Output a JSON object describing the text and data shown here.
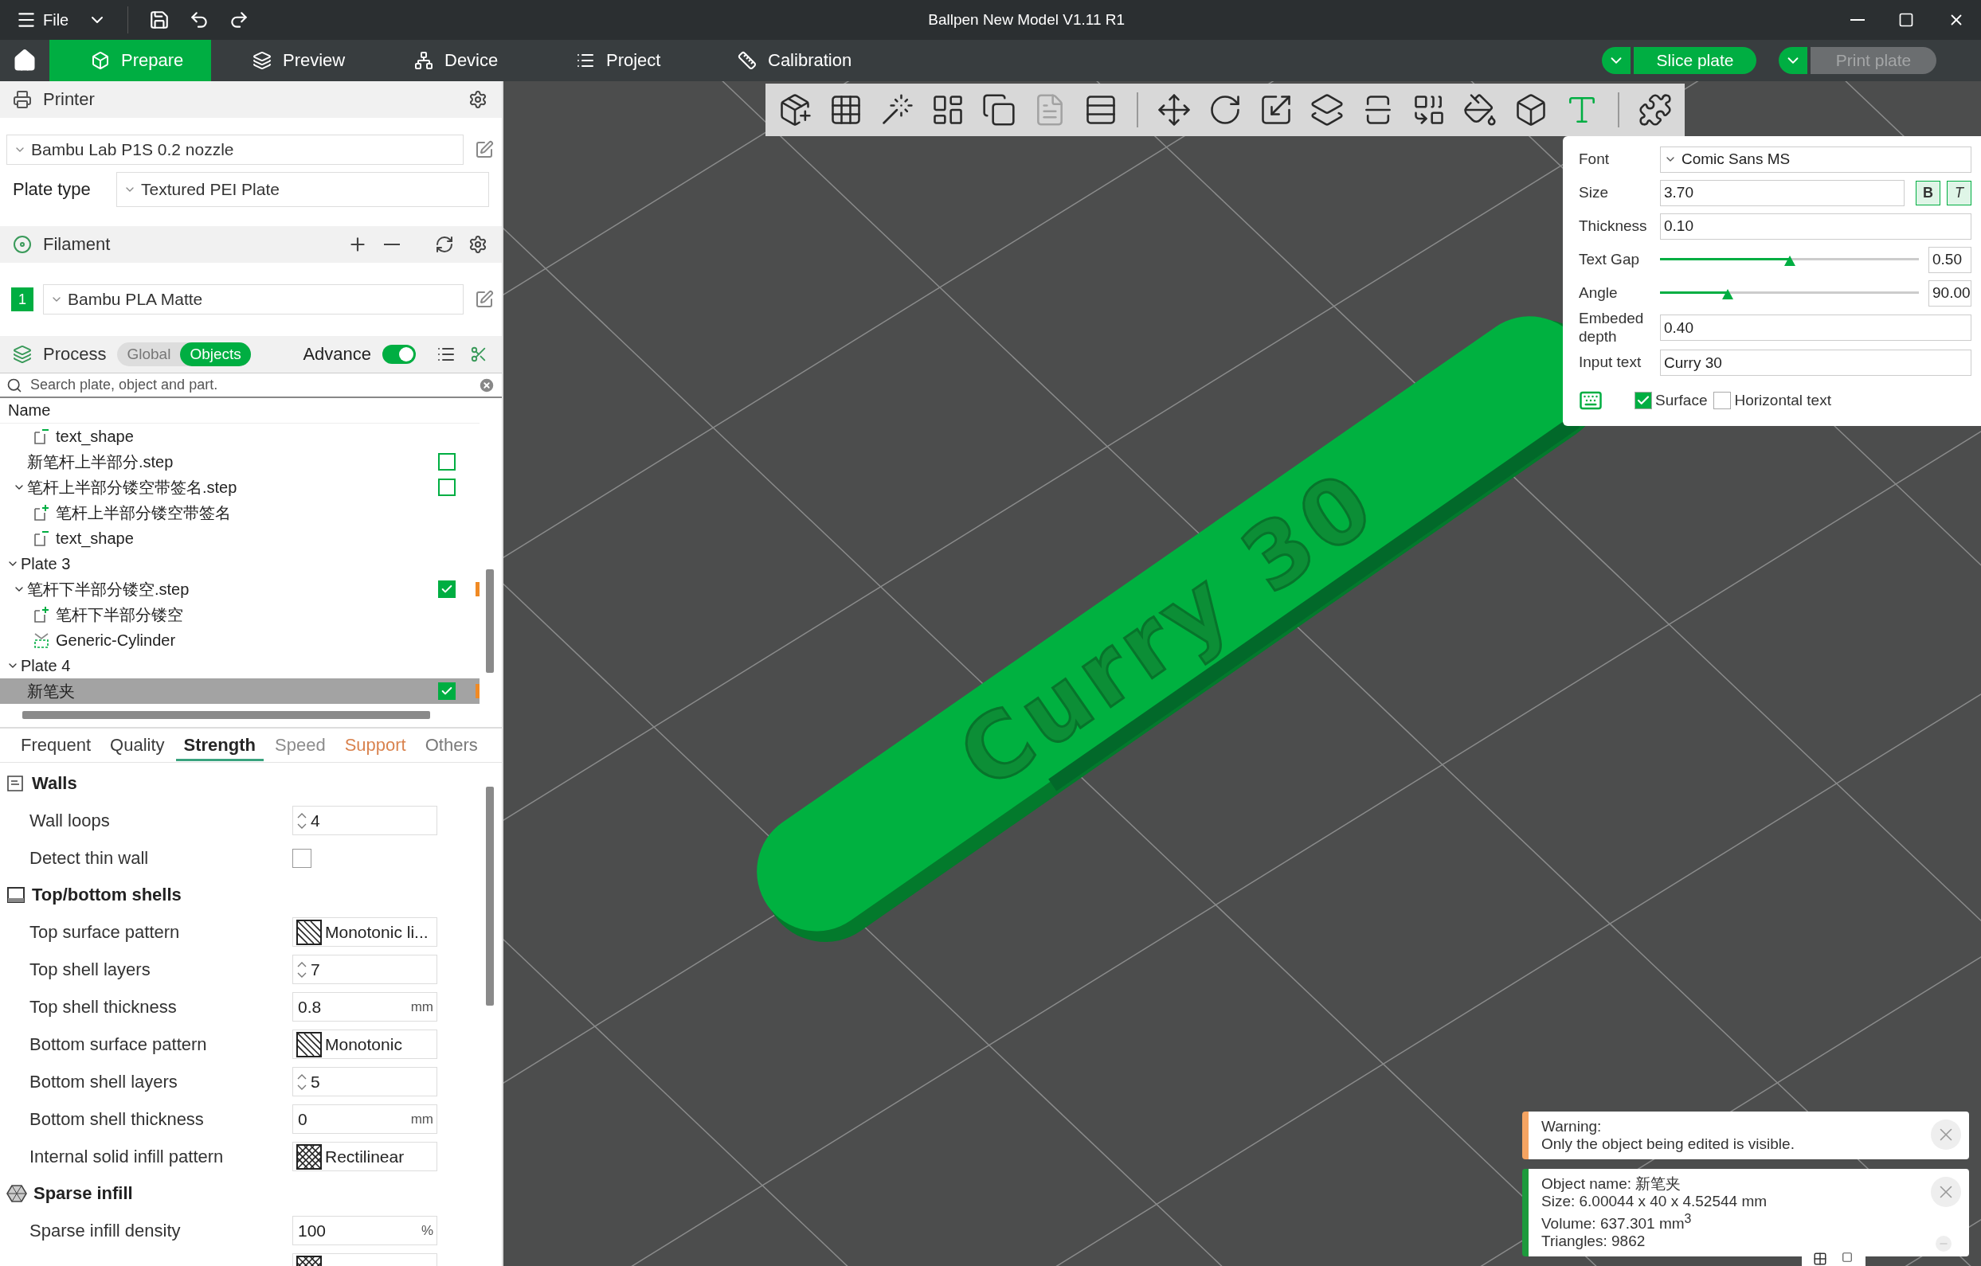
{
  "window": {
    "title": "Ballpen New Model V1.11 R1",
    "menu": "File"
  },
  "nav": {
    "tabs": [
      {
        "label": "Prepare",
        "selected": true
      },
      {
        "label": "Preview",
        "selected": false
      },
      {
        "label": "Device",
        "selected": false
      },
      {
        "label": "Project",
        "selected": false
      },
      {
        "label": "Calibration",
        "selected": false
      }
    ],
    "actions": [
      {
        "label": "Slice plate",
        "disabled": false
      },
      {
        "label": "Print plate",
        "disabled": true
      }
    ]
  },
  "printer": {
    "title": "Printer",
    "preset": "Bambu Lab P1S 0.2 nozzle",
    "plate_type_label": "Plate type",
    "plate_type": "Textured PEI Plate"
  },
  "filament": {
    "title": "Filament",
    "items": [
      {
        "index": "1",
        "name": "Bambu PLA Matte",
        "color": "#00ae42"
      }
    ]
  },
  "process": {
    "title": "Process",
    "scopes": [
      {
        "label": "Global",
        "selected": false
      },
      {
        "label": "Objects",
        "selected": true
      }
    ],
    "advance_label": "Advance",
    "advance_on": true
  },
  "search": {
    "placeholder": "Search plate, object and part."
  },
  "object_list": {
    "column": "Name",
    "items": [
      {
        "children": [
          {
            "children": [
              {
                "kind": "text",
                "label": "text_shape",
                "selected": false
              }
            ]
          },
          {
            "label": "新笔杆上半部分.step",
            "checked": false,
            "selected": false
          },
          {
            "label": "笔杆上半部分镂空带签名.step",
            "checked": false,
            "selected": false,
            "expanded": true,
            "children": [
              {
                "kind": "part",
                "label": "笔杆上半部分镂空带签名",
                "selected": false
              },
              {
                "kind": "text",
                "label": "text_shape",
                "selected": false
              }
            ]
          }
        ]
      },
      {
        "label": "Plate 3",
        "selected": false,
        "expanded": true,
        "children": [
          {
            "label": "笔杆下半部分镂空.step",
            "checked": true,
            "modified": true,
            "selected": false,
            "expanded": true,
            "children": [
              {
                "kind": "part",
                "label": "笔杆下半部分镂空",
                "selected": false
              },
              {
                "kind": "modifier",
                "label": "Generic-Cylinder",
                "selected": false
              }
            ]
          }
        ]
      },
      {
        "label": "Plate 4",
        "selected": false,
        "expanded": true,
        "children": [
          {
            "label": "新笔夹",
            "checked": true,
            "modified": true,
            "selected": true
          }
        ]
      }
    ]
  },
  "settings": {
    "tabs": [
      {
        "label": "Frequent",
        "selected": false,
        "color": "#3c3c3c"
      },
      {
        "label": "Quality",
        "selected": false,
        "color": "#3c3c3c"
      },
      {
        "label": "Strength",
        "selected": true,
        "color": "#262626"
      },
      {
        "label": "Speed",
        "selected": false,
        "color": "#8c8c8c"
      },
      {
        "label": "Support",
        "selected": false,
        "color": "#d9834f"
      },
      {
        "label": "Others",
        "selected": false,
        "color": "#7a7a7a"
      }
    ],
    "groups": [
      {
        "title": "Walls",
        "rows": [
          {
            "kind": "spin",
            "label": "Wall loops",
            "value": "4"
          },
          {
            "kind": "check",
            "label": "Detect thin wall",
            "checked": false
          }
        ]
      },
      {
        "title": "Top/bottom shells",
        "rows": [
          {
            "kind": "pattern",
            "label": "Top surface pattern",
            "value": "Monotonic li...",
            "crosshatch": false
          },
          {
            "kind": "spin",
            "label": "Top shell layers",
            "value": "7"
          },
          {
            "kind": "unit",
            "label": "Top shell thickness",
            "value": "0.8",
            "unit": "mm"
          },
          {
            "kind": "pattern",
            "label": "Bottom surface pattern",
            "value": "Monotonic",
            "crosshatch": false
          },
          {
            "kind": "spin",
            "label": "Bottom shell layers",
            "value": "5"
          },
          {
            "kind": "unit",
            "label": "Bottom shell thickness",
            "value": "0",
            "unit": "mm"
          },
          {
            "kind": "pattern",
            "label": "Internal solid infill pattern",
            "value": "Rectilinear",
            "crosshatch": true
          }
        ]
      },
      {
        "title": "Sparse infill",
        "rows": [
          {
            "kind": "unit",
            "label": "Sparse infill density",
            "value": "100",
            "unit": "%"
          },
          {
            "kind": "pattern",
            "crosshatch": true
          }
        ]
      }
    ]
  },
  "tool_groups": [
    [
      {
        "selected": false,
        "disabled": false
      },
      {
        "selected": false,
        "disabled": false
      },
      {
        "selected": false,
        "disabled": false
      },
      {
        "selected": false,
        "disabled": false
      },
      {
        "selected": false,
        "disabled": false
      },
      {
        "selected": false,
        "disabled": true
      },
      {
        "selected": false,
        "disabled": false
      }
    ],
    [
      {
        "selected": false,
        "disabled": false
      },
      {
        "selected": false,
        "disabled": false
      },
      {
        "selected": false,
        "disabled": false
      },
      {
        "selected": false,
        "disabled": false
      },
      {
        "selected": false,
        "disabled": false
      },
      {
        "selected": false,
        "disabled": false
      },
      {
        "selected": false,
        "disabled": false
      },
      {
        "selected": false,
        "disabled": false
      },
      {
        "selected": true,
        "disabled": false
      }
    ],
    [
      {
        "selected": false,
        "disabled": false
      }
    ]
  ],
  "text_tool": {
    "fields": [
      {
        "kind": "select",
        "label": "Font",
        "value": "Comic Sans MS"
      },
      {
        "kind": "style",
        "label": "Size",
        "value": "3.70",
        "styles": [
          {
            "label": "B",
            "on": true
          },
          {
            "label": "T",
            "on": true
          }
        ]
      },
      {
        "kind": "input",
        "label": "Thickness",
        "value": "0.10"
      },
      {
        "kind": "slider",
        "label": "Text Gap",
        "value": "0.50",
        "level": 0.5
      },
      {
        "kind": "slider",
        "label": "Angle",
        "value": "90.00",
        "level": 0.26
      },
      {
        "kind": "input",
        "label": "Embeded depth",
        "value": "0.40"
      },
      {
        "kind": "input",
        "label": "Input text",
        "value": "Curry 30"
      }
    ],
    "options": [
      {
        "label": "Surface",
        "checked": true
      },
      {
        "label": "Horizontal text",
        "checked": false
      }
    ]
  },
  "viewport": {
    "model_text": "Curry 30"
  },
  "notifications": [
    {
      "kind": "warning",
      "lines": [
        "Warning:",
        "Only the object being edited is visible."
      ]
    },
    {
      "kind": "info",
      "lines": [
        "Object name: 新笔夹",
        "Size: 6.00044 x 40 x 4.52544 mm",
        "Volume: 637.301 mm$^{3}$",
        "Triangles: 9862"
      ]
    }
  ]
}
